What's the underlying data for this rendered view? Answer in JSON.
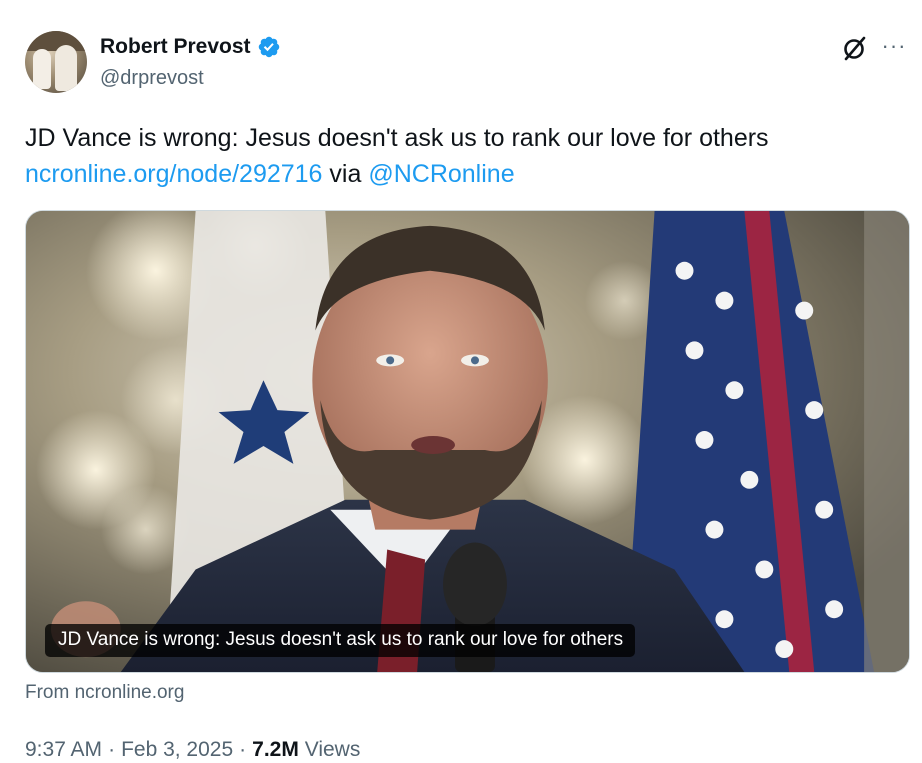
{
  "author": {
    "display_name": "Robert Prevost",
    "handle": "@drprevost",
    "verified": true,
    "verified_color": "#1d9bf0"
  },
  "toolbar": {
    "grok_icon": "grok-slash-circle-icon",
    "more_label": "···"
  },
  "tweet": {
    "text": "JD Vance is wrong: Jesus doesn't ask us to rank our love for others",
    "link_text": "ncronline.org/node/292716",
    "via_text": " via ",
    "mention_text": "@NCRonline",
    "link_color": "#1d9bf0"
  },
  "card": {
    "caption": "JD Vance is wrong: Jesus doesn't ask us to rank our love for others",
    "source": "From ncronline.org"
  },
  "meta": {
    "time": "9:37 AM",
    "separator": "·",
    "date": "Feb 3, 2025",
    "views_count": "7.2M",
    "views_label": "Views"
  }
}
